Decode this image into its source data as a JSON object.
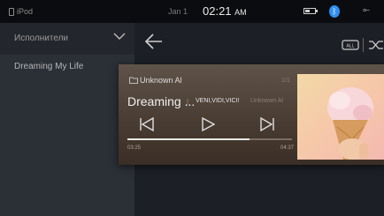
{
  "status_bar": {
    "app_name": "iPod",
    "date": "Jan 1",
    "time": "02:21",
    "ampm": "AM",
    "icons": [
      "battery-icon",
      "bluetooth-icon",
      "usb-icon"
    ]
  },
  "sidebar": {
    "title": "Исполнители",
    "items": [
      {
        "label": "Dreaming My Life"
      }
    ]
  },
  "now_playing": {
    "album_label": "Unknown Al",
    "track_index": "1/1",
    "title": "Dreaming ...",
    "separator": "|",
    "artist": "VENI,VIDI,VICI!",
    "album": "Unknown Al",
    "elapsed": "03:25",
    "total": "04:37",
    "progress": 0.74
  },
  "colors": {
    "accent_bluetooth": "#2f8ff0",
    "card_bg": "#5f5349",
    "sidebar_bg": "#2b2f36",
    "statusbar_bg": "#0b0c0f"
  }
}
